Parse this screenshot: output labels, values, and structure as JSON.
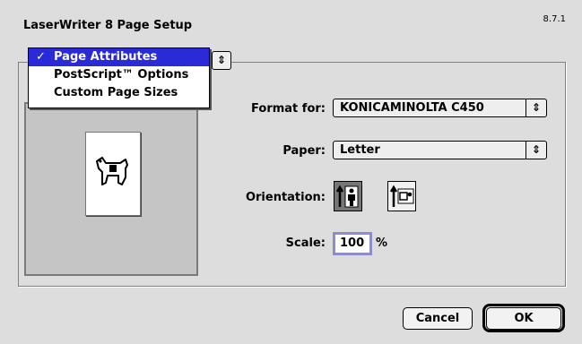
{
  "dialog": {
    "title": "LaserWriter 8 Page Setup",
    "version": "8.7.1"
  },
  "section_menu": {
    "items": [
      {
        "label": "Page Attributes",
        "selected": true,
        "check": "✓"
      },
      {
        "label": "PostScript™ Options",
        "selected": false
      },
      {
        "label": "Custom Page Sizes",
        "selected": false
      }
    ],
    "popup_icon": "updown-arrows-icon"
  },
  "preview": {
    "icon": "dogcow-icon"
  },
  "format_for": {
    "label": "Format for:",
    "value": "KONICAMINOLTA C450"
  },
  "paper": {
    "label": "Paper:",
    "value": "Letter"
  },
  "orientation": {
    "label": "Orientation:",
    "selected": "portrait"
  },
  "scale": {
    "label": "Scale:",
    "value": "100",
    "unit": "%"
  },
  "buttons": {
    "cancel": "Cancel",
    "ok": "OK"
  },
  "colors": {
    "highlight": "#2a2ad6",
    "background": "#dddddd"
  }
}
